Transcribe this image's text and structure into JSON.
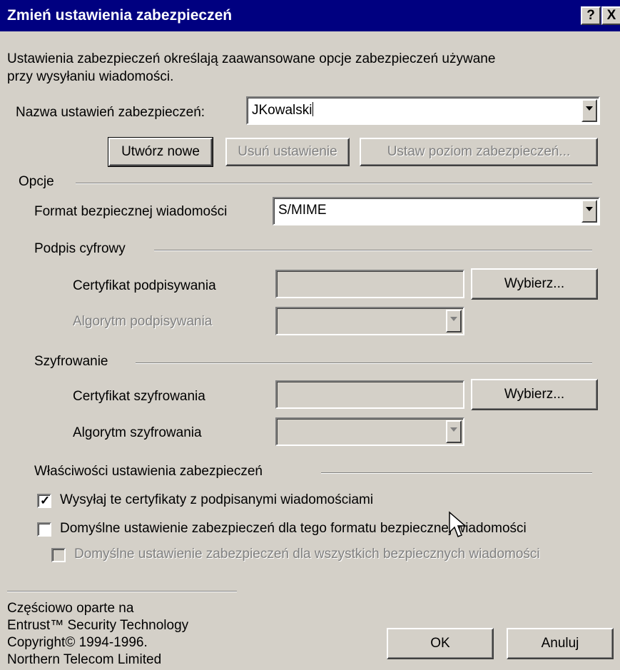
{
  "title": "Zmień ustawienia zabezpieczeń",
  "title_buttons": {
    "help": "?",
    "close": "X"
  },
  "description_line1": "Ustawienia zabezpieczeń określają zaawansowane opcje zabezpieczeń używane",
  "description_line2": "przy wysyłaniu wiadomości.",
  "name_label": "Nazwa ustawień zabezpieczeń:",
  "name_value": "JKowalski",
  "buttons": {
    "create": "Utwórz nowe",
    "delete": "Usuń ustawienie",
    "level": "Ustaw poziom zabezpieczeń...",
    "choose_sign": "Wybierz...",
    "choose_enc": "Wybierz...",
    "ok": "OK",
    "cancel": "Anuluj"
  },
  "options_group": "Opcje",
  "format_label": "Format bezpiecznej wiadomości",
  "format_value": "S/MIME",
  "sign_group": "Podpis cyfrowy",
  "sign_cert_label": "Certyfikat podpisywania",
  "sign_cert_value": "",
  "sign_alg_label": "Algorytm podpisywania",
  "sign_alg_value": "",
  "enc_group": "Szyfrowanie",
  "enc_cert_label": "Certyfikat szyfrowania",
  "enc_cert_value": "",
  "enc_alg_label": "Algorytm szyfrowania",
  "enc_alg_value": "",
  "props_group": "Właściwości ustawienia zabezpieczeń",
  "checkboxes": [
    {
      "label": "Wysyłaj te certyfikaty z podpisanymi wiadomościami",
      "checked": true,
      "enabled": true
    },
    {
      "label": "Domyślne ustawienie zabezpieczeń dla tego formatu bezpiecznej wiadomości",
      "checked": false,
      "enabled": true
    },
    {
      "label": "Domyślne ustawienie zabezpieczeń dla wszystkich bezpiecznych wiadomości",
      "checked": false,
      "enabled": false
    }
  ],
  "footer": [
    "Częściowo oparte na",
    "Entrust™ Security Technology",
    "Copyright© 1994-1996.",
    "Northern Telecom Limited"
  ]
}
